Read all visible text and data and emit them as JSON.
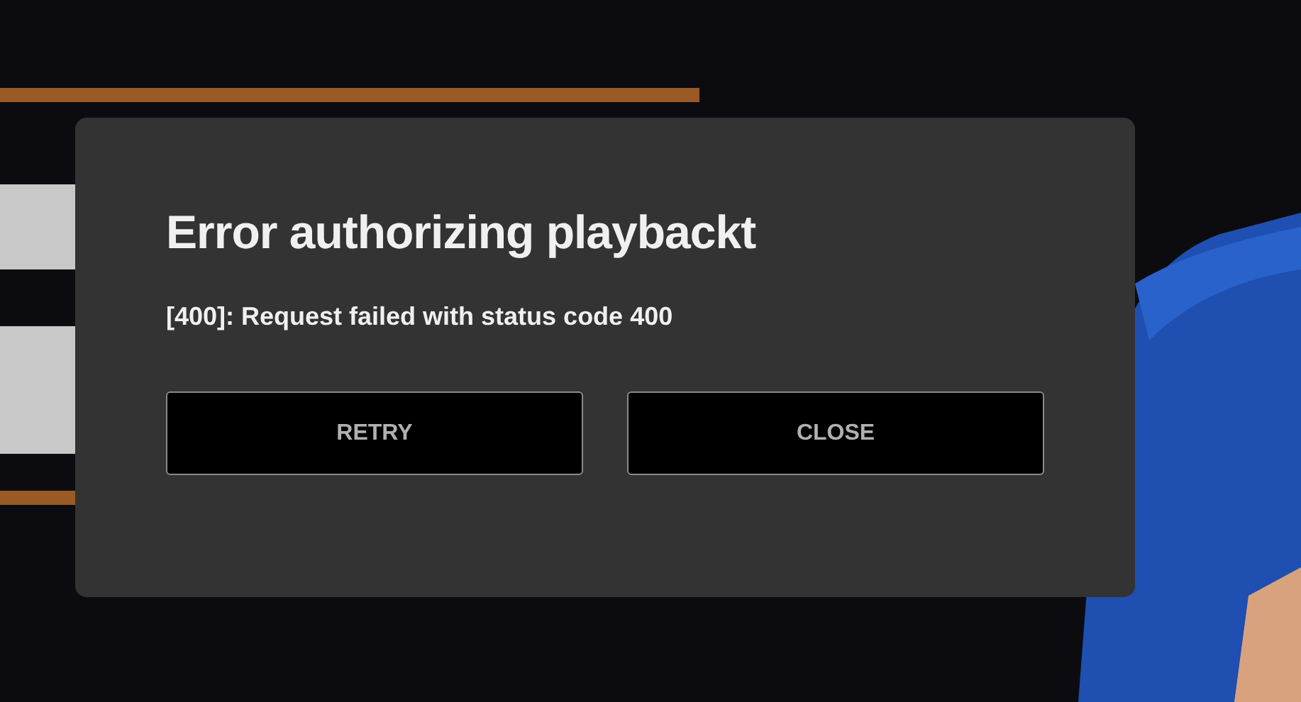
{
  "dialog": {
    "title": "Error authorizing playbackt",
    "message": "[400]: Request failed with status code 400",
    "buttons": [
      {
        "label": "RETRY"
      },
      {
        "label": "CLOSE"
      }
    ]
  }
}
